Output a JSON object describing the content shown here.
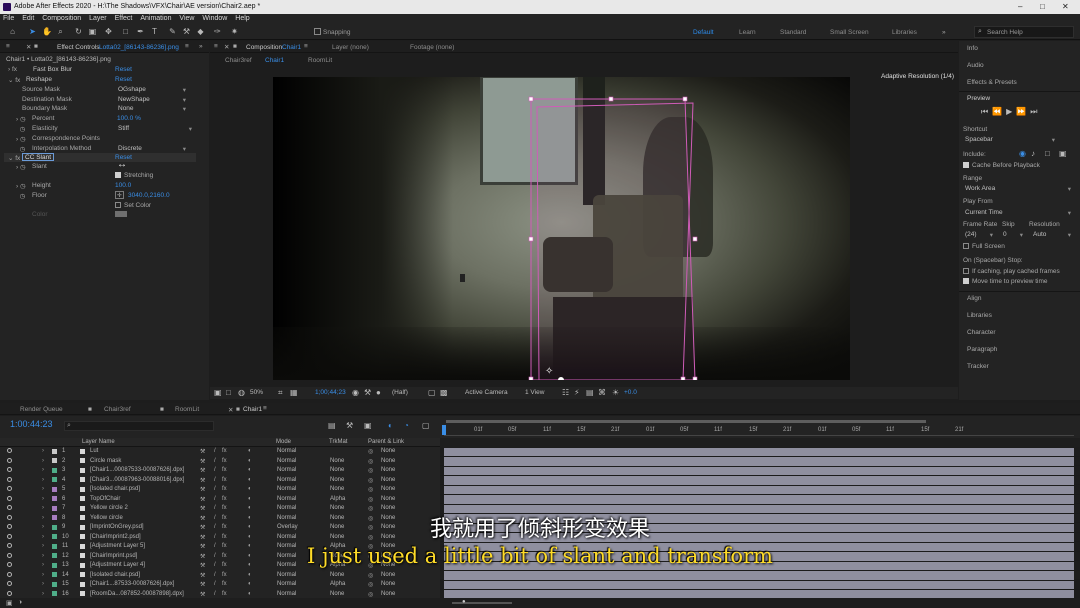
{
  "window": {
    "title": "Adobe After Effects 2020 - H:\\The Shadows\\VFX\\Chair\\AE version\\Chair2.aep *"
  },
  "menu": [
    "File",
    "Edit",
    "Composition",
    "Layer",
    "Effect",
    "Animation",
    "View",
    "Window",
    "Help"
  ],
  "toolbar": {
    "snapping": "Snapping",
    "workspaces": [
      "Default",
      "Learn",
      "Standard",
      "Small Screen",
      "Libraries"
    ],
    "search_placeholder": "Search Help"
  },
  "effect_controls": {
    "tab_label": "Effect Controls",
    "tab_layer": "Lotta02_[86143-86236].png",
    "header": "Chair1 • Lotta02_[86143-86236].png",
    "effects": [
      {
        "name": "Fast Box Blur",
        "reset": "Reset"
      },
      {
        "name": "Reshape",
        "reset": "Reset"
      }
    ],
    "props": [
      {
        "label": "Source Mask",
        "value": "OGshape"
      },
      {
        "label": "Destination Mask",
        "value": "NewShape"
      },
      {
        "label": "Boundary Mask",
        "value": "None"
      },
      {
        "label": "Percent",
        "value": "100.0 %"
      },
      {
        "label": "Elasticity",
        "value": "Stiff"
      },
      {
        "label": "Correspondence Points",
        "value": ""
      },
      {
        "label": "Interpolation Method",
        "value": "Discrete"
      }
    ],
    "slant": {
      "name": "CC Slant",
      "reset": "Reset"
    },
    "slant_props": [
      {
        "label": "Slant",
        "value": ""
      },
      {
        "label": "Stretching",
        "value": "Stretching"
      },
      {
        "label": "Height",
        "value": "100.0"
      },
      {
        "label": "Floor",
        "value": "3040.0,2160.0"
      },
      {
        "label": "",
        "value": "Set Color"
      },
      {
        "label": "Color",
        "value": ""
      }
    ]
  },
  "composition": {
    "tab_label": "Composition",
    "tab_comp": "Chair1",
    "layer_tab": "Layer (none)",
    "footage_tab": "Footage (none)",
    "breadcrumbs": [
      "Chair3ref",
      "Chair1",
      "RoomLit"
    ],
    "adaptive": "Adaptive Resolution (1/4)",
    "footer": {
      "zoom": "50%",
      "timecode": "1;00;44;23",
      "resolution": "(Half)",
      "camera": "Active Camera",
      "views": "1 View",
      "offset": "+0.0"
    }
  },
  "right_panel": {
    "items": [
      "Info",
      "Audio",
      "Effects & Presets"
    ],
    "preview": {
      "title": "Preview",
      "shortcut_label": "Shortcut",
      "shortcut": "Spacebar",
      "include_label": "Include:",
      "cache_before": "Cache Before Playback",
      "range_label": "Range",
      "range": "Work Area",
      "play_from_label": "Play From",
      "play_from": "Current Time",
      "frame_rate_label": "Frame Rate",
      "skip_label": "Skip",
      "resolution_label": "Resolution",
      "frame_rate": "(24)",
      "skip": "0",
      "resolution": "Auto",
      "full_screen": "Full Screen",
      "on_stop": "On (Spacebar) Stop:",
      "if_caching": "If caching, play cached frames",
      "move_time": "Move time to preview time"
    },
    "more": [
      "Align",
      "Libraries",
      "Character",
      "Paragraph",
      "Tracker"
    ]
  },
  "timeline": {
    "tabs": [
      "Render Queue",
      "Chair3ref",
      "RoomLit",
      "Chair1"
    ],
    "timecode": "1:00:44:23",
    "columns": {
      "name": "Layer Name",
      "mode": "Mode",
      "trkmat": "TrkMat",
      "parent": "Parent & Link"
    },
    "ruler": [
      "01f",
      "05f",
      "11f",
      "15f",
      "21f",
      "01f",
      "05f",
      "11f",
      "15f",
      "21f",
      "01f",
      "05f",
      "11f",
      "15f",
      "21f"
    ],
    "rows": [
      {
        "num": "1",
        "name": "Lut",
        "mode": "Normal",
        "trkmat": "",
        "parent": "None",
        "color": "#c8c8c8"
      },
      {
        "num": "2",
        "name": "Circle mask",
        "mode": "Normal",
        "trkmat": "None",
        "parent": "None",
        "color": "#c8c8c8"
      },
      {
        "num": "3",
        "name": "[Chair1...00087533-00087626].dpx]",
        "mode": "Normal",
        "trkmat": "None",
        "parent": "None",
        "color": "#4fae89"
      },
      {
        "num": "4",
        "name": "[Chair3...00087963-00088016].dpx]",
        "mode": "Normal",
        "trkmat": "None",
        "parent": "None",
        "color": "#4fae89"
      },
      {
        "num": "5",
        "name": "[Isolated chair.psd]",
        "mode": "Normal",
        "trkmat": "None",
        "parent": "None",
        "color": "#a77dc0"
      },
      {
        "num": "6",
        "name": "TopOfChair",
        "mode": "Normal",
        "trkmat": "Alpha",
        "parent": "None",
        "color": "#a77dc0"
      },
      {
        "num": "7",
        "name": "Yellow circle 2",
        "mode": "Normal",
        "trkmat": "None",
        "parent": "None",
        "color": "#a77dc0"
      },
      {
        "num": "8",
        "name": "Yellow circle",
        "mode": "Normal",
        "trkmat": "None",
        "parent": "None",
        "color": "#a77dc0"
      },
      {
        "num": "9",
        "name": "[ImprintOnGrey.psd]",
        "mode": "Overlay",
        "trkmat": "None",
        "parent": "None",
        "color": "#4fae89"
      },
      {
        "num": "10",
        "name": "[ChairImprint2.psd]",
        "mode": "Normal",
        "trkmat": "None",
        "parent": "None",
        "color": "#4fae89"
      },
      {
        "num": "11",
        "name": "[Adjustment Layer 5]",
        "mode": "Normal",
        "trkmat": "Alpha",
        "parent": "None",
        "color": "#4fae89"
      },
      {
        "num": "12",
        "name": "[ChairImprint.psd]",
        "mode": "Normal",
        "trkmat": "None",
        "parent": "None",
        "color": "#4fae89"
      },
      {
        "num": "13",
        "name": "[Adjustment Layer 4]",
        "mode": "Normal",
        "trkmat": "Alpha",
        "parent": "None",
        "color": "#4fae89"
      },
      {
        "num": "14",
        "name": "[Isolated chair.psd]",
        "mode": "Normal",
        "trkmat": "None",
        "parent": "None",
        "color": "#4fae89"
      },
      {
        "num": "15",
        "name": "[Chair1...87533-00087626].dpx]",
        "mode": "Normal",
        "trkmat": "Alpha",
        "parent": "None",
        "color": "#4fae89"
      },
      {
        "num": "16",
        "name": "[RoomDa...087852-00087898].dpx]",
        "mode": "Normal",
        "trkmat": "None",
        "parent": "None",
        "color": "#4fae89"
      }
    ]
  },
  "subtitles": {
    "cn": "我就用了倾斜形变效果",
    "en": "I just used a little bit of slant and transform"
  }
}
